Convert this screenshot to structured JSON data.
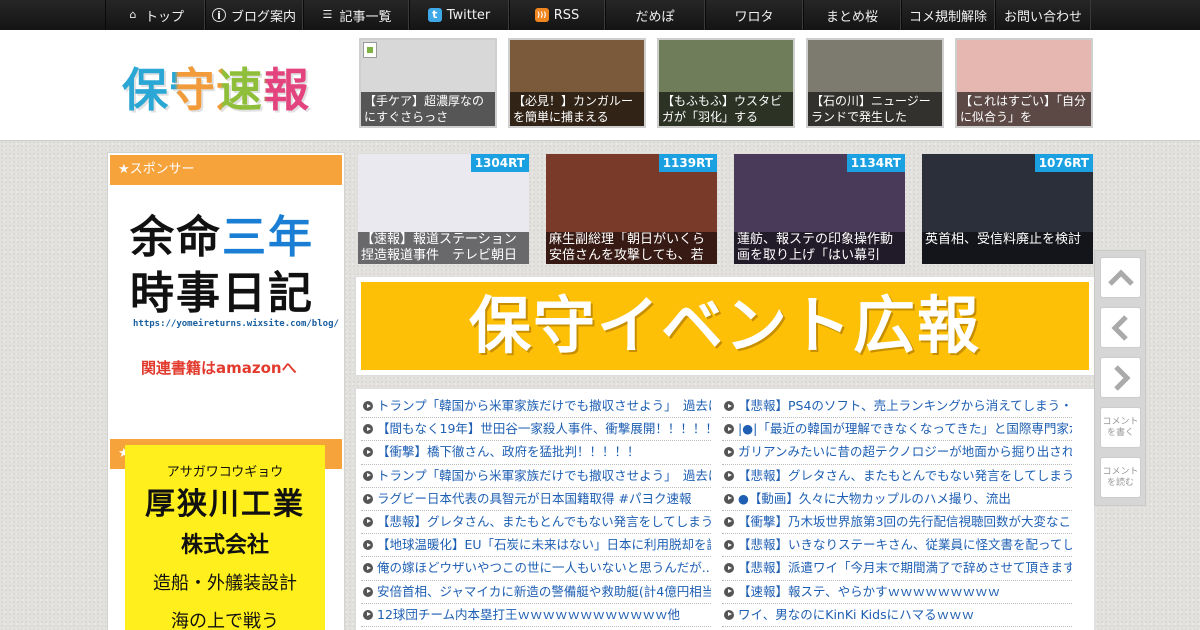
{
  "nav": {
    "items": [
      {
        "label": "トップ",
        "icon": "home-icon",
        "width": 100
      },
      {
        "label": "ブログ案内",
        "icon": "info-icon",
        "width": 98
      },
      {
        "label": "記事一覧",
        "icon": "list-icon",
        "width": 106
      },
      {
        "label": "Twitter",
        "icon": "twitter-icon",
        "width": 100
      },
      {
        "label": "RSS",
        "icon": "rss-icon",
        "width": 96
      },
      {
        "label": "だめぽ",
        "icon": "",
        "width": 100
      },
      {
        "label": "ワロタ",
        "icon": "",
        "width": 98
      },
      {
        "label": "まとめ桜",
        "icon": "",
        "width": 98
      },
      {
        "label": "コメ規制解除",
        "icon": "",
        "width": 94
      },
      {
        "label": "お問い合わせ",
        "icon": "",
        "width": 96
      }
    ]
  },
  "header": {
    "logo": "保守速報",
    "thumbs": [
      {
        "caption": "【手ケア】超濃厚なのにすぐさらっさ",
        "bg": "#d8d8d8",
        "broken": true
      },
      {
        "caption": "【必見！】カンガルーを簡単に捕まえる",
        "bg": "#7a5a3a",
        "broken": false
      },
      {
        "caption": "【もふもふ】ウスタビガが「羽化」する",
        "bg": "#6f7d5a",
        "broken": false
      },
      {
        "caption": "【石の川】ニュージーランドで発生した",
        "bg": "#7d7a70",
        "broken": false
      },
      {
        "caption": "【これはすごい】「自分に似合う」を",
        "bg": "#e6b7b0",
        "broken": false
      }
    ]
  },
  "sidebar": {
    "sponsor_label": "★スポンサー",
    "ad1": {
      "line1_a": "余命",
      "line1_b": "三年",
      "line2": "時事日記",
      "url": "https://yomeireturns.wixsite.com/blog/",
      "amazon": "関連書籍はamazonへ"
    },
    "sponsor_label2": "★スポンサー",
    "ad2": {
      "kana": "アサガワコウギョウ",
      "name": "厚狭川工業",
      "company": "株式会社",
      "service": "造船・外艤装設計",
      "more": "海の上で戦う"
    }
  },
  "ranks": [
    {
      "rt": "1304RT",
      "caption": "【速報】報道ステーション捏造報道事件　テレビ朝日",
      "bg": "#e9e9ef"
    },
    {
      "rt": "1139RT",
      "caption": "麻生副総理「朝日がいくら安倍さんを攻撃しても、若",
      "bg": "#7a3a2a"
    },
    {
      "rt": "1134RT",
      "caption": "蓮舫、報ステの印象操作動画を取り上げ「はい幕引",
      "bg": "#4a3a5a"
    },
    {
      "rt": "1076RT",
      "caption": "英首相、受信料廃止を検討",
      "bg": "#2b2f3a"
    }
  ],
  "banner": {
    "text": "保守イベント広報"
  },
  "links": {
    "left": [
      "トランプ「韓国から米軍家族だけでも撤収させよう」　過去に",
      "【間もなく19年】世田谷一家殺人事件、衝撃展開！！！！！",
      "【衝撃】橋下徹さん、政府を猛批判！！！！！",
      "トランプ「韓国から米軍家族だけでも撤収させよう」　過去に",
      "ラグビー日本代表の具智元が日本国籍取得 #パヨク速報",
      "【悲報】グレタさん、またもとんでもない発言をしてしまうw",
      "【地球温暖化】EU「石炭に未来はない」日本に利用脱却を訴え",
      "俺の嫁ほどウザいやつこの世に一人もいないと思うんだが...",
      "安倍首相、ジャマイカに新造の警備艇や救助艇(計4億円相当)を",
      "12球団チーム内本塁打王ｗｗｗｗｗｗｗｗｗｗｗｗ他"
    ],
    "right": [
      "【悲報】PS4のソフト、売上ランキングから消えてしまう・・",
      "|●|「最近の韓国が理解できなくなってきた」と国際専門家が困",
      "ガリアンみたいに昔の超テクノロジーが地面から掘り出されて",
      "【悲報】グレタさん、またもとんでもない発言をしてしまうw",
      "●【動画】久々に大物カップルのハメ撮り、流出",
      "【衝撃】乃木坂世界旅第3回の先行配信視聴回数が大変なことに",
      "【悲報】いきなりステーキさん、従業員に怪文書を配ってしま",
      "【悲報】派遣ワイ「今月末で期間満了で辞めさせて頂きますね",
      "【速報】報ステ、やらかすｗｗｗｗｗｗｗｗｗ",
      "ワイ、男なのにKinKi Kidsにハマるｗｗｗ"
    ]
  },
  "tools": {
    "comment_write": "コメントを書く",
    "comment_read": "コメントを読む"
  }
}
